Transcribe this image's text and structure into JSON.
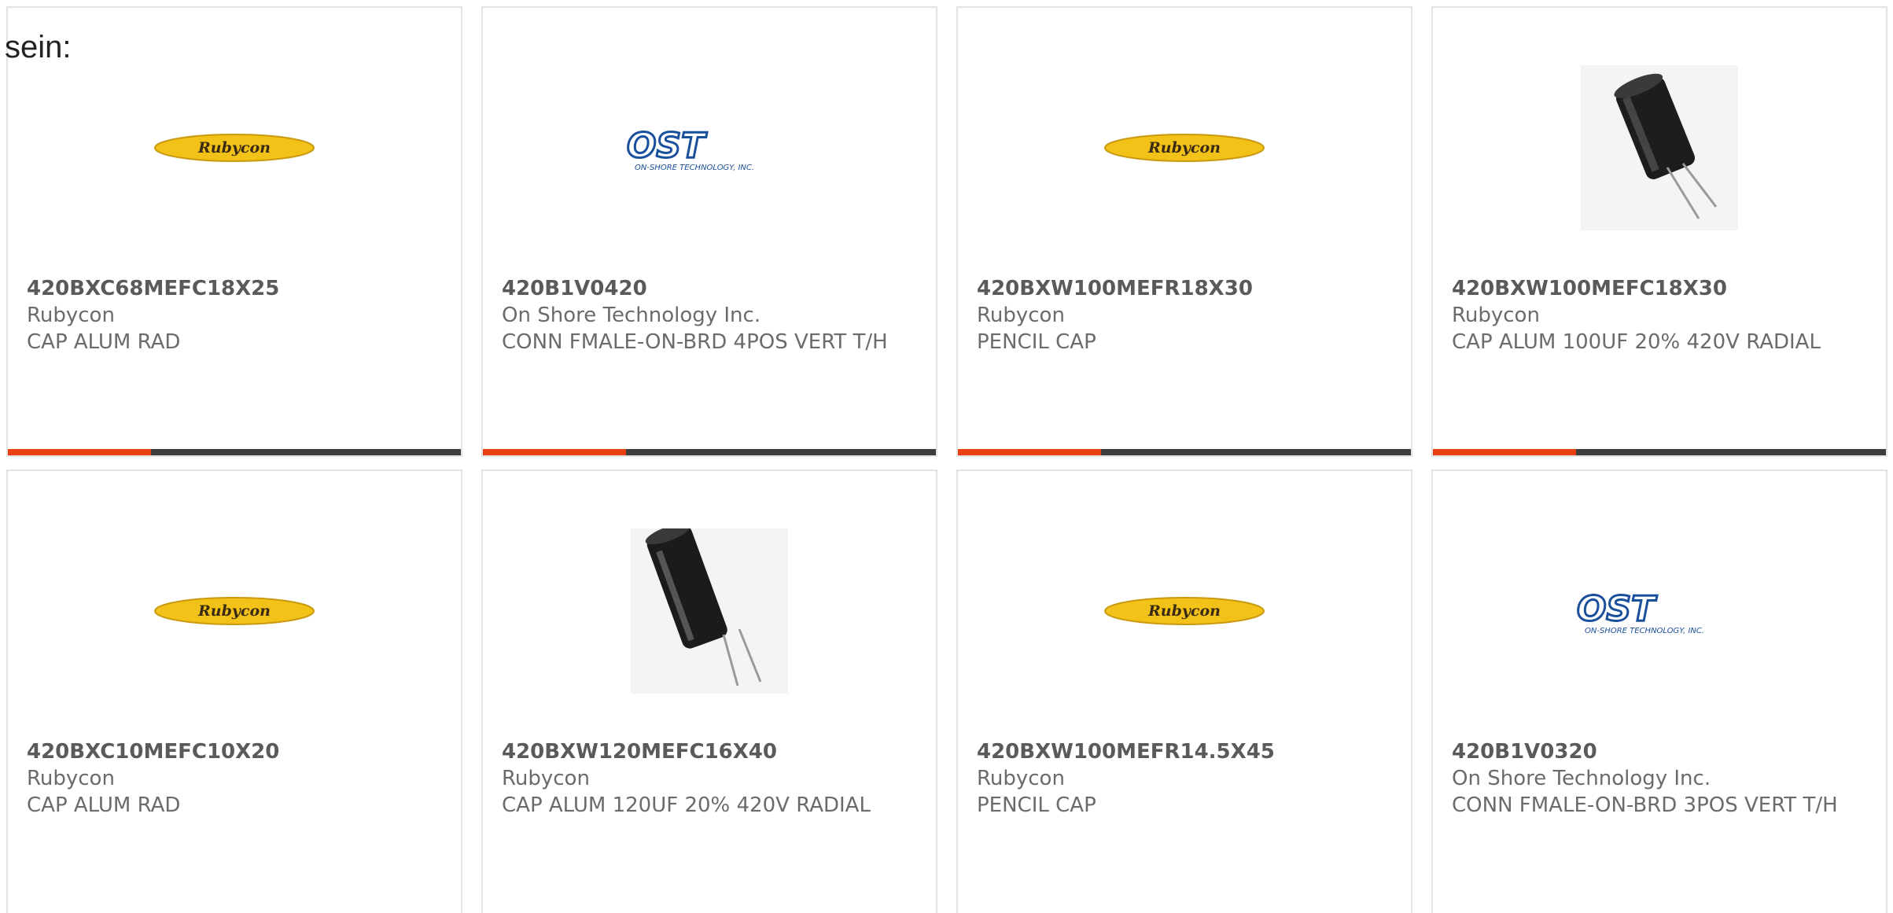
{
  "lead_text": "sein:",
  "accent_color": "#e8400f",
  "cards": [
    {
      "part_number": "420BXC68MEFC18X25",
      "manufacturer": "Rubycon",
      "description": "CAP ALUM RAD",
      "image": "rubycon-logo"
    },
    {
      "part_number": "420B1V0420",
      "manufacturer": "On Shore Technology Inc.",
      "description": "CONN FMALE-ON-BRD 4POS VERT T/H",
      "image": "ost-logo",
      "logo_text": "OST",
      "logo_subtext": "ON-SHORE TECHNOLOGY, INC."
    },
    {
      "part_number": "420BXW100MEFR18X30",
      "manufacturer": "Rubycon",
      "description": "PENCIL CAP",
      "image": "rubycon-logo"
    },
    {
      "part_number": "420BXW100MEFC18X30",
      "manufacturer": "Rubycon",
      "description": "CAP ALUM 100UF 20% 420V RADIAL",
      "image": "capacitor-photo"
    },
    {
      "part_number": "420BXC10MEFC10X20",
      "manufacturer": "Rubycon",
      "description": "CAP ALUM RAD",
      "image": "rubycon-logo"
    },
    {
      "part_number": "420BXW120MEFC16X40",
      "manufacturer": "Rubycon",
      "description": "CAP ALUM 120UF 20% 420V RADIAL",
      "image": "capacitor-photo-long"
    },
    {
      "part_number": "420BXW100MEFR14.5X45",
      "manufacturer": "Rubycon",
      "description": "PENCIL CAP",
      "image": "rubycon-logo"
    },
    {
      "part_number": "420B1V0320",
      "manufacturer": "On Shore Technology Inc.",
      "description": "CONN FMALE-ON-BRD 3POS VERT T/H",
      "image": "ost-logo",
      "logo_text": "OST",
      "logo_subtext": "ON-SHORE TECHNOLOGY, INC."
    }
  ]
}
